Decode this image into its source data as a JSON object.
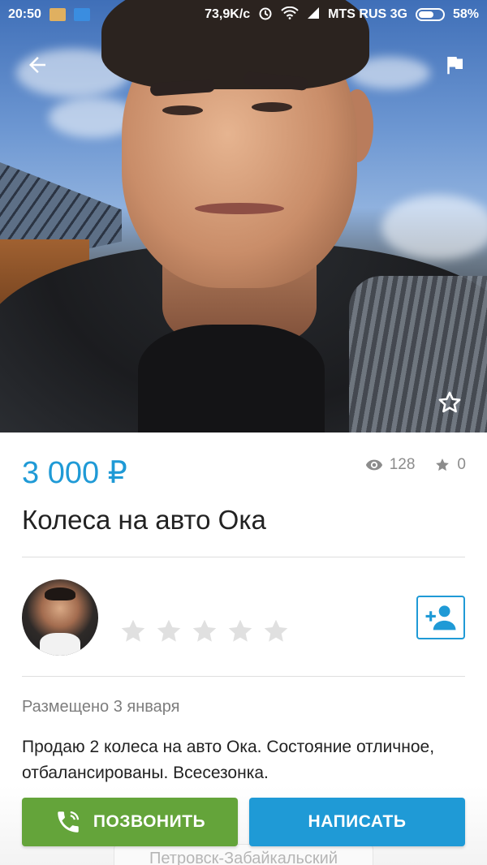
{
  "status_bar": {
    "time": "20:50",
    "speed": "73,9K/c",
    "carrier": "MTS RUS 3G",
    "battery": "58%"
  },
  "listing": {
    "price": "3 000 ₽",
    "views": "128",
    "favorites": "0",
    "title": "Колеса на авто Ока",
    "posted": "Размещено 3 января",
    "description": "Продаю 2 колеса на авто Ока. Состояние отличное, отбалансированы. Всесезонка.",
    "location": "Петровск-Забайкальский"
  },
  "seller": {
    "rating_stars": 0,
    "rating_max": 5
  },
  "actions": {
    "call_label": "ПОЗВОНИТЬ",
    "write_label": "НАПИСАТЬ"
  },
  "colors": {
    "accent": "#1f9ad6",
    "call": "#64a43a",
    "star_empty": "#e0e0e0"
  },
  "icons": {
    "back": "arrow-left-icon",
    "report": "flag-icon",
    "favorite": "star-outline-icon",
    "views": "eye-icon",
    "favorites_count": "star-icon",
    "add_friend": "person-add-icon",
    "call": "phone-icon"
  }
}
